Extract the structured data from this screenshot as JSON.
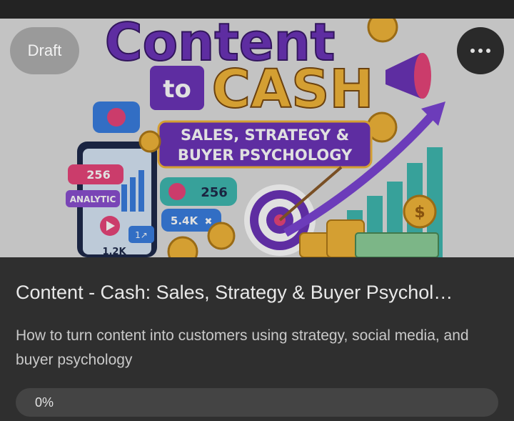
{
  "status_bar": {},
  "card": {
    "status_badge": "Draft",
    "more_icon": "more-horizontal-icon",
    "title": "Content - Cash: Sales, Strategy & Buyer Psychol…",
    "description": "How to turn content into customers using strategy, social media, and buyer psychology",
    "progress": {
      "value": 0,
      "label": "0%"
    },
    "cover": {
      "headline": "Content",
      "to_text": "to",
      "cash_text": "CASH",
      "banner_line1": "SALES, STRATEGY &",
      "banner_line2": "BUYER PSYCHOLOGY",
      "phone_stat_1": "256",
      "phone_stat_2": "ANALYTIC",
      "phone_stat_3": "1.2K",
      "phone_stat_4": "1↗",
      "bubble_likes": "256",
      "bubble_views": "5.4K",
      "coin_symbol": "$",
      "colors": {
        "purple": "#6b34b8",
        "gold": "#f2b63a",
        "teal": "#3fb8b0",
        "pink": "#e8457a"
      }
    }
  }
}
